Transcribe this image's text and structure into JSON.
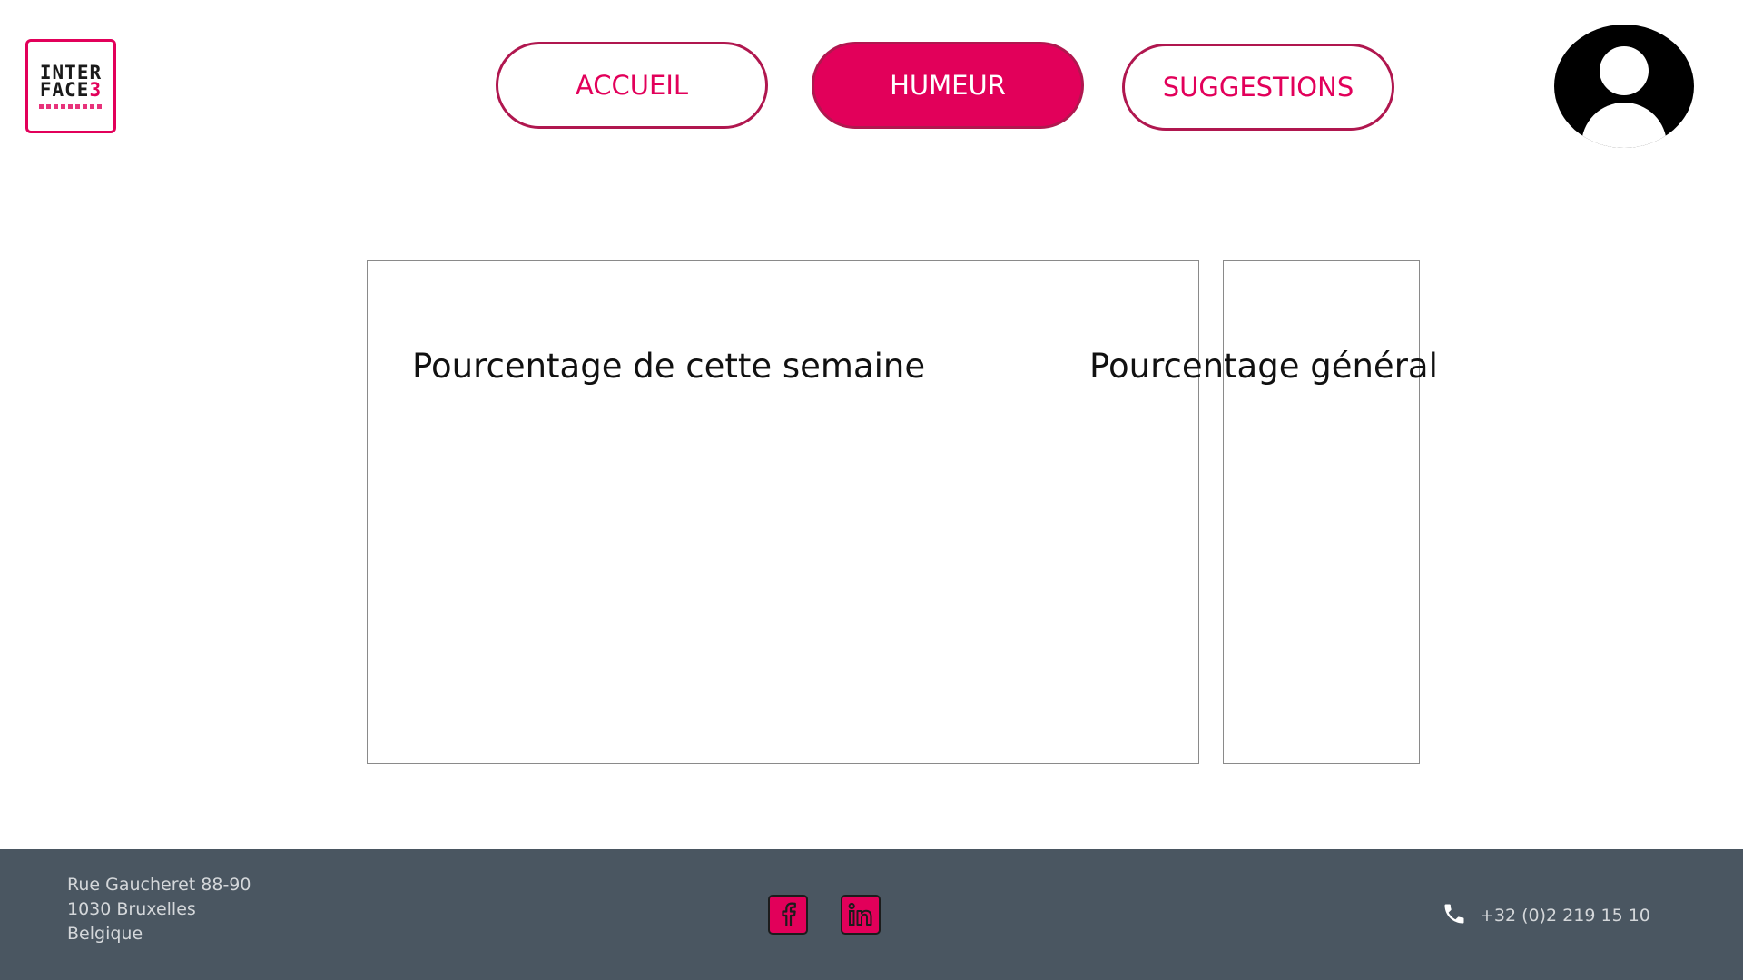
{
  "header": {
    "logo": {
      "line1": "INTER",
      "line2_main": "FACE",
      "line2_accent": "3"
    },
    "nav": [
      {
        "label": "ACCUEIL",
        "active": false
      },
      {
        "label": "HUMEUR",
        "active": true
      },
      {
        "label": "SUGGESTIONS",
        "active": false
      }
    ],
    "profile_icon": "user-avatar-icon"
  },
  "main": {
    "weekly_title": "Pourcentage de cette semaine",
    "general_title": "Pourcentage général"
  },
  "footer": {
    "address_line1": "Rue Gaucheret 88-90",
    "address_line2": "1030 Bruxelles",
    "address_line3": "Belgique",
    "social": [
      "facebook-icon",
      "linkedin-icon"
    ],
    "phone_icon": "phone-icon",
    "phone": "+32 (0)2 219 15 10"
  },
  "colors": {
    "accent": "#e2005a",
    "footer_bg": "#4a5661",
    "footer_text": "#d4d7da"
  }
}
